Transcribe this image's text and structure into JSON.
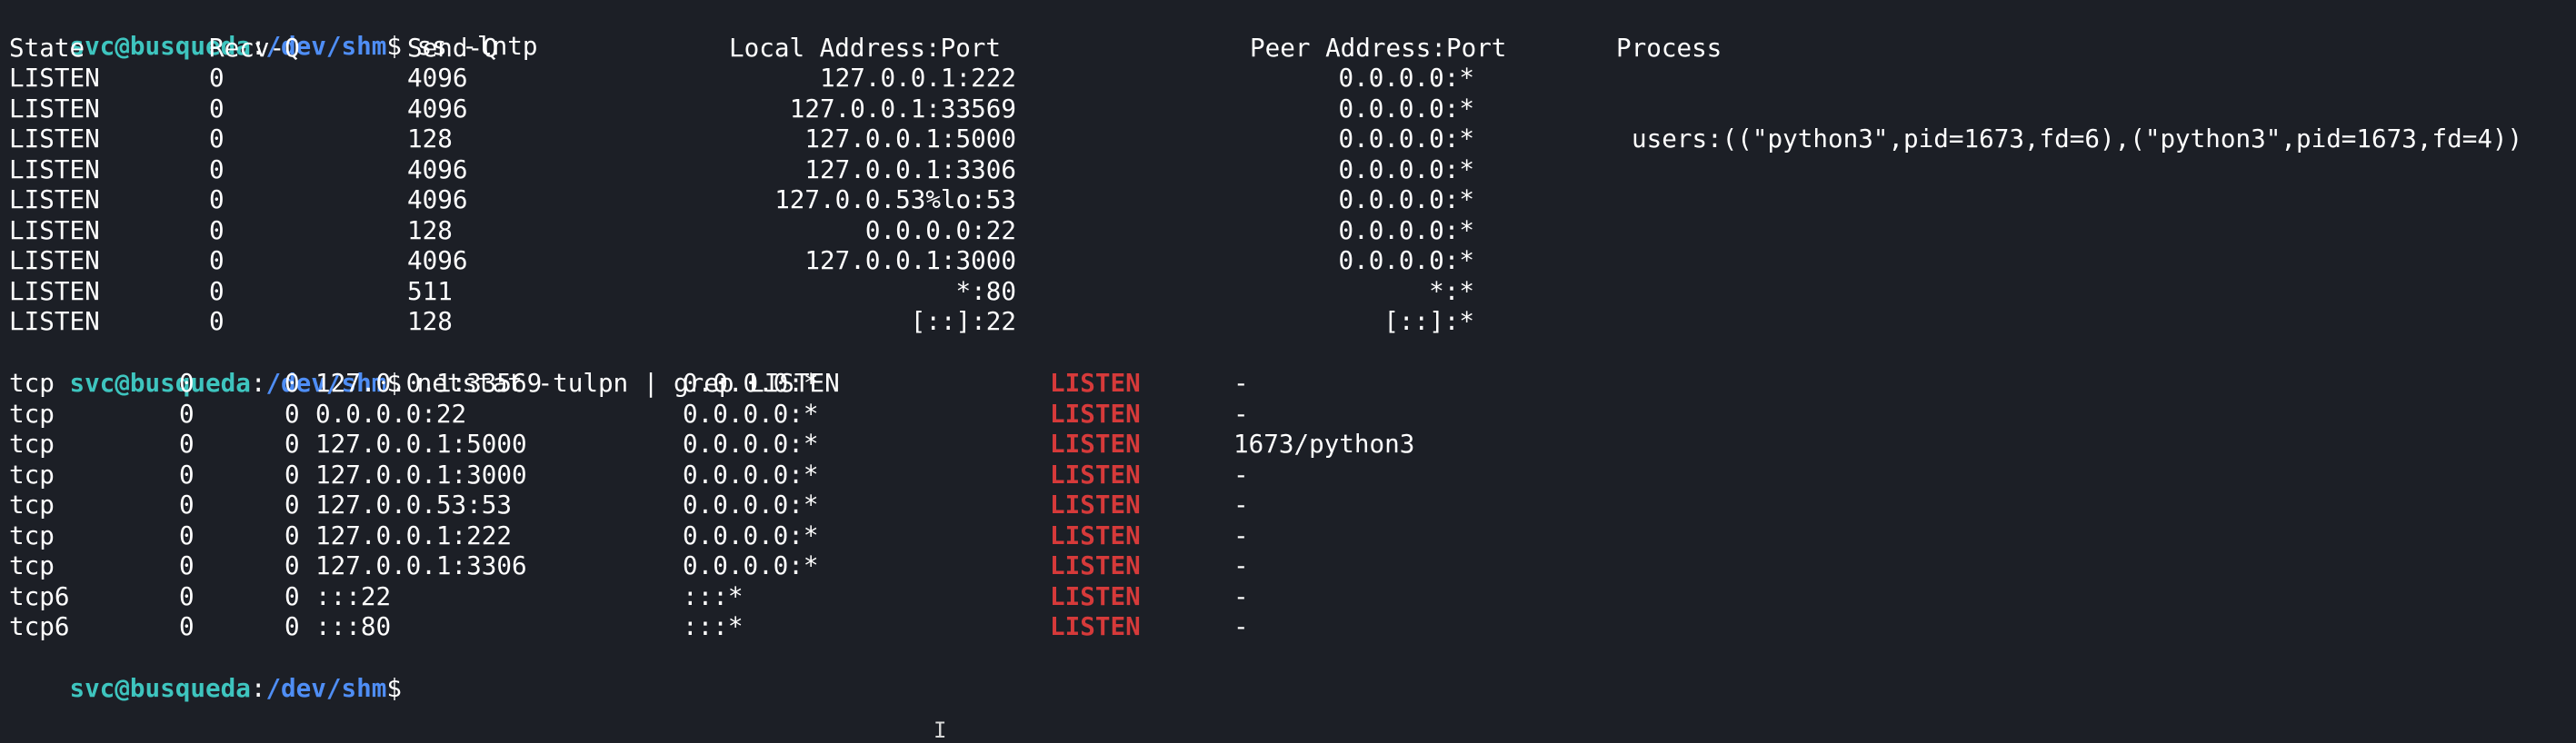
{
  "prompt": {
    "user": "svc@busqueda",
    "sep": ":",
    "path": "/dev/shm",
    "symbol": "$"
  },
  "commands": [
    "ss -lntp",
    "netstat -tulpn | grep LISTEN"
  ],
  "ss": {
    "headers": {
      "state": "State",
      "recvq": "Recv-Q",
      "sendq": "Send-Q",
      "local": "Local Address:Port",
      "peer": "Peer Address:Port",
      "process": "Process"
    },
    "rows": [
      {
        "state": "LISTEN",
        "recvq": "0",
        "sendq": "4096",
        "local": "127.0.0.1:222",
        "peer": "0.0.0.0:*",
        "process": ""
      },
      {
        "state": "LISTEN",
        "recvq": "0",
        "sendq": "4096",
        "local": "127.0.0.1:33569",
        "peer": "0.0.0.0:*",
        "process": ""
      },
      {
        "state": "LISTEN",
        "recvq": "0",
        "sendq": "128",
        "local": "127.0.0.1:5000",
        "peer": "0.0.0.0:*",
        "process": "users:((\"python3\",pid=1673,fd=6),(\"python3\",pid=1673,fd=4))"
      },
      {
        "state": "LISTEN",
        "recvq": "0",
        "sendq": "4096",
        "local": "127.0.0.1:3306",
        "peer": "0.0.0.0:*",
        "process": ""
      },
      {
        "state": "LISTEN",
        "recvq": "0",
        "sendq": "4096",
        "local": "127.0.0.53%lo:53",
        "peer": "0.0.0.0:*",
        "process": ""
      },
      {
        "state": "LISTEN",
        "recvq": "0",
        "sendq": "128",
        "local": "0.0.0.0:22",
        "peer": "0.0.0.0:*",
        "process": ""
      },
      {
        "state": "LISTEN",
        "recvq": "0",
        "sendq": "4096",
        "local": "127.0.0.1:3000",
        "peer": "0.0.0.0:*",
        "process": ""
      },
      {
        "state": "LISTEN",
        "recvq": "0",
        "sendq": "511",
        "local": "*:80",
        "peer": "*:*",
        "process": ""
      },
      {
        "state": "LISTEN",
        "recvq": "0",
        "sendq": "128",
        "local": "[::]:22",
        "peer": "[::]:*",
        "process": ""
      }
    ]
  },
  "netstat": {
    "rows": [
      {
        "proto": "tcp",
        "recvq": "0",
        "sendq": "0",
        "local": "127.0.0.1:33569",
        "foreign": "0.0.0.0:*",
        "state": "LISTEN",
        "pid": "-"
      },
      {
        "proto": "tcp",
        "recvq": "0",
        "sendq": "0",
        "local": "0.0.0.0:22",
        "foreign": "0.0.0.0:*",
        "state": "LISTEN",
        "pid": "-"
      },
      {
        "proto": "tcp",
        "recvq": "0",
        "sendq": "0",
        "local": "127.0.0.1:5000",
        "foreign": "0.0.0.0:*",
        "state": "LISTEN",
        "pid": "1673/python3"
      },
      {
        "proto": "tcp",
        "recvq": "0",
        "sendq": "0",
        "local": "127.0.0.1:3000",
        "foreign": "0.0.0.0:*",
        "state": "LISTEN",
        "pid": "-"
      },
      {
        "proto": "tcp",
        "recvq": "0",
        "sendq": "0",
        "local": "127.0.0.53:53",
        "foreign": "0.0.0.0:*",
        "state": "LISTEN",
        "pid": "-"
      },
      {
        "proto": "tcp",
        "recvq": "0",
        "sendq": "0",
        "local": "127.0.0.1:222",
        "foreign": "0.0.0.0:*",
        "state": "LISTEN",
        "pid": "-"
      },
      {
        "proto": "tcp",
        "recvq": "0",
        "sendq": "0",
        "local": "127.0.0.1:3306",
        "foreign": "0.0.0.0:*",
        "state": "LISTEN",
        "pid": "-"
      },
      {
        "proto": "tcp6",
        "recvq": "0",
        "sendq": "0",
        "local": ":::22",
        "foreign": ":::*",
        "state": "LISTEN",
        "pid": "-"
      },
      {
        "proto": "tcp6",
        "recvq": "0",
        "sendq": "0",
        "local": ":::80",
        "foreign": ":::*",
        "state": "LISTEN",
        "pid": "-"
      }
    ]
  },
  "cursor_glyph": "I",
  "colors": {
    "background": "#1c1f26",
    "user": "#3ec5bf",
    "path": "#4f8ef5",
    "text": "#ffffff",
    "listen": "#d63a3a"
  }
}
